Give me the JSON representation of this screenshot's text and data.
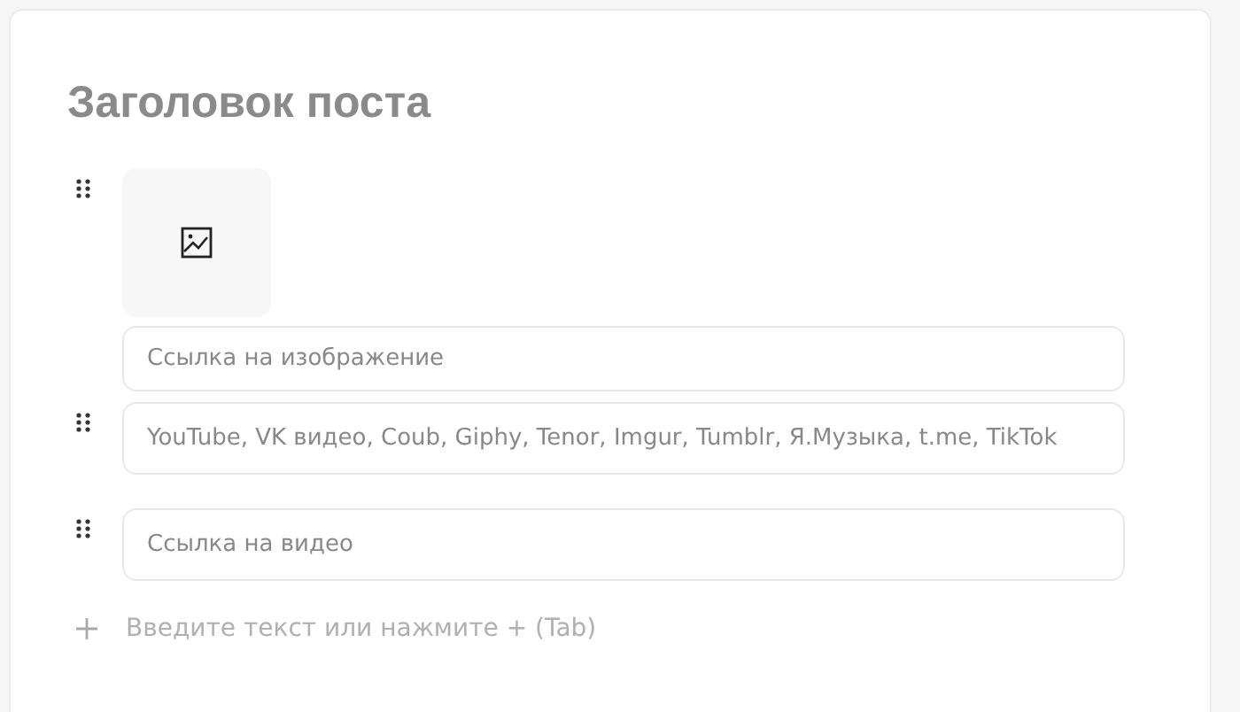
{
  "title": "Заголовок поста",
  "blocks": [
    {
      "kind": "image",
      "placeholder": "Ссылка на изображение"
    },
    {
      "kind": "field",
      "placeholder": "YouTube, VK видео, Coub, Giphy, Tenor, Imgur, Tumblr, Я.Музыка, t.me, TikTok"
    },
    {
      "kind": "field",
      "placeholder": "Ссылка на видео"
    }
  ],
  "add_row": {
    "placeholder": "Введите текст или нажмите + (Tab)"
  }
}
